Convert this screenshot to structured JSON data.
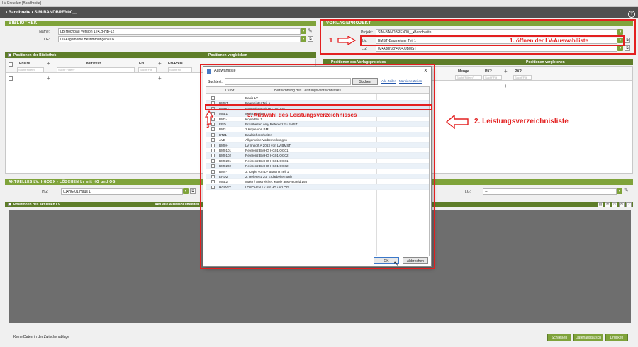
{
  "window_title": "LV Erstellen [Bandbreite]",
  "app_title": "• Bandbreite • SIM-BANDBREN00__",
  "help": "?",
  "bibliothek": {
    "header": "BIBLIOTHEK",
    "name_label": "Name:",
    "name_value": "LB Hochbau Version 12•LB-HB-12",
    "lg_label": "LG:",
    "lg_value": "00•Allgemeine Bestimmungen•00•",
    "positions_header": "Positionen der Bibliothek",
    "compare_header": "Positionen vergleichen",
    "columns": [
      "Pos.Nr.",
      "Kurztext",
      "EH",
      "EH-Preis"
    ],
    "filters": [
      "Suchf\"Filtern\"",
      "Suchf\"Filtern\"",
      "Suchf\"Filt",
      "Suchf\"Filt"
    ]
  },
  "vorlage": {
    "header": "VORLAGEPROJEKT",
    "projekt_label": "Projekt:",
    "projekt_value": "SIM-BANDBREN00__•Bandbreite",
    "lv_label": "LV:",
    "lv_value": "BMST•Baumeister Teil 1",
    "lg_label": "LG:",
    "lg_value": "02•Abbruch•00•00BMST",
    "positions_header": "Positionen des Vorlageprojektes",
    "compare_header": "Positionen vergleichen",
    "columns": [
      "Menge",
      "PK2",
      "PK2"
    ],
    "filters": [
      "Suchf\"Filtern\"",
      "Suchf\"Filt",
      "Suchf\"Filt"
    ]
  },
  "aktuell": {
    "header": "AKTUELLES LV: HGOGX - LÖSCHEN Lv mit HG und OG",
    "hg_label": "HG:",
    "hg_value": "01•HG 01 Haus 1",
    "lg_label": "LG:",
    "lg_value": "---",
    "positions_header": "Positionen des aktuellen LV",
    "selection_header": "Aktuelle Auswahl umleiten..."
  },
  "annotations": {
    "a1_num": "1",
    "a1_text": "1. öffnen der LV-Auswahlliste",
    "a2_text": "2. Leistungsverzeichnisliste",
    "a3_num": "3",
    "a3_text": "3. Auswahl des Leistungsverzeichnisses",
    "colors": {
      "annotation": "#e32020",
      "accent": "#7fa33a",
      "header_dark": "#505050"
    }
  },
  "dialog": {
    "title": "Auswahlliste",
    "search_label": "Suchtext:",
    "search_value": "",
    "search_button": "Suchen",
    "link_all": "Alle Zeilen",
    "link_marked": "Markierte Zeilen",
    "col1": "LV-Nr",
    "col2": "Bezeichnung des Leistungsverzeichnisses",
    "rows": [
      {
        "nr": "-------",
        "name": "Basis-LV",
        "checked": false
      },
      {
        "nr": "BMST",
        "name": "Baumeister Teil 1",
        "checked": false
      },
      {
        "nr": "BMHG",
        "name": "Baumeister mit HG und OG",
        "checked": true
      },
      {
        "nr": "MAL1",
        "name": "Malerarbeiten",
        "checked": false
      },
      {
        "nr": "BM2-",
        "name": "Kopie BM 1",
        "checked": false
      },
      {
        "nr": "ERD",
        "name": "Erdarbeiten only Referenz zu BMST",
        "checked": false
      },
      {
        "nr": "BM3",
        "name": "2.Kopie von BM1",
        "checked": false
      },
      {
        "nr": "BT21",
        "name": "Baulsicherarbeiten",
        "checked": false
      },
      {
        "nr": "AVB",
        "name": "Allgemeine Vorbemerkungen",
        "checked": false
      },
      {
        "nr": "BM0H",
        "name": "LV Import A 2063 von LV BMST",
        "checked": false
      },
      {
        "nr": "BM0101",
        "name": "Referenz BMHG HG01 OG01",
        "checked": false
      },
      {
        "nr": "BM0102",
        "name": "Referenz BMHG HG01 OG02",
        "checked": false
      },
      {
        "nr": "BM0201",
        "name": "Referenz BMHG HG01 OG01",
        "checked": false
      },
      {
        "nr": "BM0202",
        "name": "Referenz BMHG HG01 OG02",
        "checked": false
      },
      {
        "nr": "BM4-",
        "name": "3. Kopie von LV BMSTR Teil 1",
        "checked": false
      },
      {
        "nr": "ERD2",
        "name": "2. Referenz zur Erdarbeiten only",
        "checked": false
      },
      {
        "nr": "MAL2",
        "name": "Maler / Anstreicher, Kopie aus Neufeld 193",
        "checked": false
      },
      {
        "nr": "HGOGX",
        "name": "LÖSCHEN Lv mit HG und OG",
        "checked": false
      }
    ],
    "ok": "OK",
    "cancel": "Abbrechen",
    "close": "×"
  },
  "footer": {
    "status": "Keine Daten in der Zwischenablage",
    "btn_close": "Schließen",
    "btn_exchange": "Datenaustausch",
    "btn_print": "Drucken"
  }
}
